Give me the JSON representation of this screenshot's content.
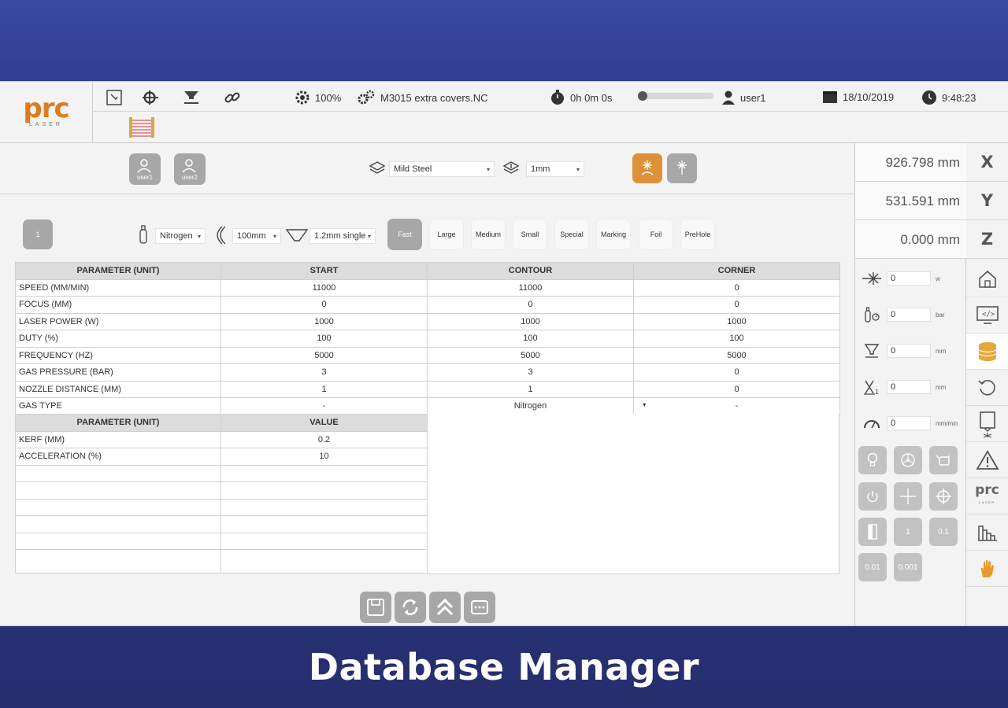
{
  "header": {
    "logo_text": "prc",
    "logo_sub": "LASER",
    "speed": "100%",
    "program": "M3015 extra covers.NC",
    "timer": "0h 0m 0s",
    "progress": 0.0,
    "user": "user1",
    "date": "18/10/2019",
    "time": "9:48:23"
  },
  "users": {
    "user1": "user1",
    "user2": "user2"
  },
  "material": {
    "value": "Mild Steel",
    "thickness": "1mm"
  },
  "cut_settings": {
    "table_number": "1",
    "gas": "Nitrogen",
    "lens": "100mm",
    "nozzle": "1.2mm single",
    "options": [
      "Fast",
      "Large",
      "Medium",
      "Small",
      "Special",
      "Marking",
      "Foil",
      "PreHole"
    ],
    "active_option": "Fast"
  },
  "table": {
    "headers": [
      "PARAMETER (UNIT)",
      "START",
      "CONTOUR",
      "CORNER"
    ],
    "rows": [
      [
        "SPEED (MM/MIN)",
        "11000",
        "11000",
        "0"
      ],
      [
        "FOCUS (MM)",
        "0",
        "0",
        "0"
      ],
      [
        "LASER POWER (W)",
        "1000",
        "1000",
        "1000"
      ],
      [
        "DUTY (%)",
        "100",
        "100",
        "100"
      ],
      [
        "FREQUENCY (HZ)",
        "5000",
        "5000",
        "5000"
      ],
      [
        "GAS PRESSURE (BAR)",
        "3",
        "3",
        "0"
      ],
      [
        "NOZZLE DISTANCE (MM)",
        "1",
        "1",
        "0"
      ],
      [
        "GAS TYPE",
        "-",
        "Nitrogen",
        "-"
      ]
    ]
  },
  "kerf_table": {
    "headers": [
      "PARAMETER (UNIT)",
      "VALUE"
    ],
    "rows": [
      [
        "KERF (MM)",
        "0.2"
      ],
      [
        "ACCELERATION (%)",
        "10"
      ]
    ]
  },
  "coordinates": {
    "x": "926.798 mm",
    "y": "531.591 mm",
    "z": "0.000 mm",
    "x_label": "X",
    "y_label": "Y",
    "z_label": "Z"
  },
  "live_params": [
    {
      "icon": "laser-power-icon",
      "value": "0",
      "unit": "w"
    },
    {
      "icon": "gas-pressure-icon",
      "value": "0",
      "unit": "bar"
    },
    {
      "icon": "nozzle-height-icon",
      "value": "0",
      "unit": "mm"
    },
    {
      "icon": "axis-distance-icon",
      "value": "0",
      "unit": "mm"
    },
    {
      "icon": "feed-rate-icon",
      "value": "0",
      "unit": "mm/min"
    }
  ],
  "jog": {
    "step1": "1",
    "step01": "0.1",
    "step001": "0.01",
    "step0001": "0.001"
  },
  "caption": "Database Manager",
  "colors": {
    "accent": "#e07a1c",
    "button_gray": "#a7a7a7",
    "active_orange": "#dd9138"
  }
}
